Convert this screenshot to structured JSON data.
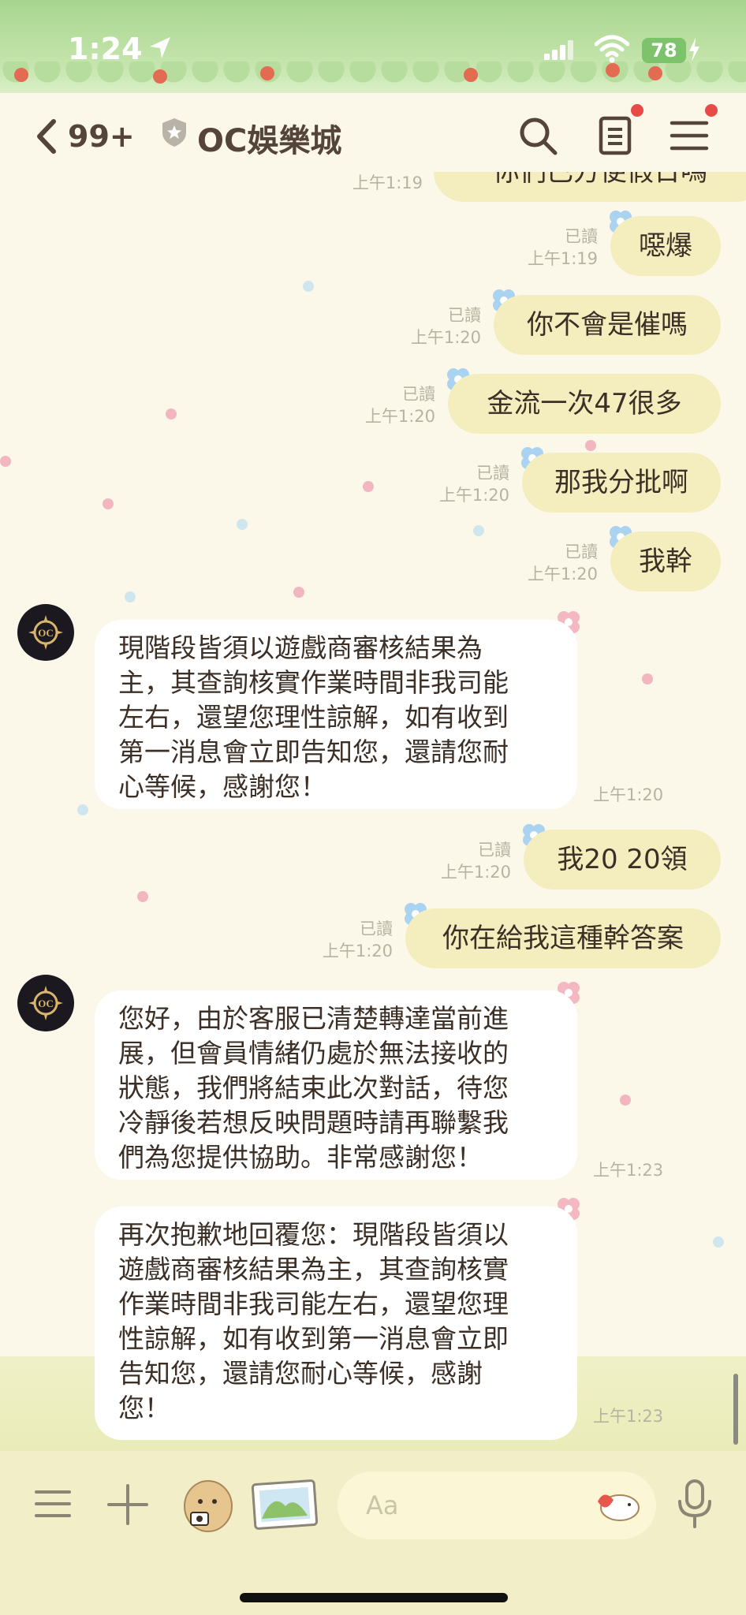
{
  "status_bar": {
    "time": "1:24",
    "battery": "78"
  },
  "header": {
    "unread_count": "99+",
    "title": "OC娛樂城"
  },
  "partial_top": {
    "text": "你們已方便假日嗎",
    "time": "上午1:19"
  },
  "sent_messages": [
    {
      "text": "噁爆",
      "read": "已讀",
      "time": "上午1:19"
    },
    {
      "text": "你不會是催嗎",
      "read": "已讀",
      "time": "上午1:20"
    },
    {
      "text": "金流一次47很多",
      "read": "已讀",
      "time": "上午1:20"
    },
    {
      "text": "那我分批啊",
      "read": "已讀",
      "time": "上午1:20"
    },
    {
      "text": "我幹",
      "read": "已讀",
      "time": "上午1:20"
    },
    {
      "text": "我20 20領",
      "read": "已讀",
      "time": "上午1:20"
    },
    {
      "text": "你在給我這種幹答案",
      "read": "已讀",
      "time": "上午1:20"
    }
  ],
  "received_messages": [
    {
      "text": "現階段皆須以遊戲商審核結果為\n主，其查詢核實作業時間非我司能\n左右，還望您理性諒解，如有收到\n第一消息會立即告知您，還請您耐\n心等候，感謝您！",
      "time": "上午1:20"
    },
    {
      "text": "您好，由於客服已清楚轉達當前進\n展，但會員情緒仍處於無法接收的\n狀態，我們將結束此次對話，待您\n冷靜後若想反映問題時請再聯繫我\n們為您提供協助。非常感謝您！",
      "time": "上午1:23"
    },
    {
      "text": "再次抱歉地回覆您：現階段皆須以\n遊戲商審核結果為主，其查詢核實\n作業時間非我司能左右，還望您理\n性諒解，如有收到第一消息會立即\n告知您，還請您耐心等候，感謝\n您！",
      "time": "上午1:23"
    }
  ],
  "input": {
    "placeholder": "Aa"
  }
}
